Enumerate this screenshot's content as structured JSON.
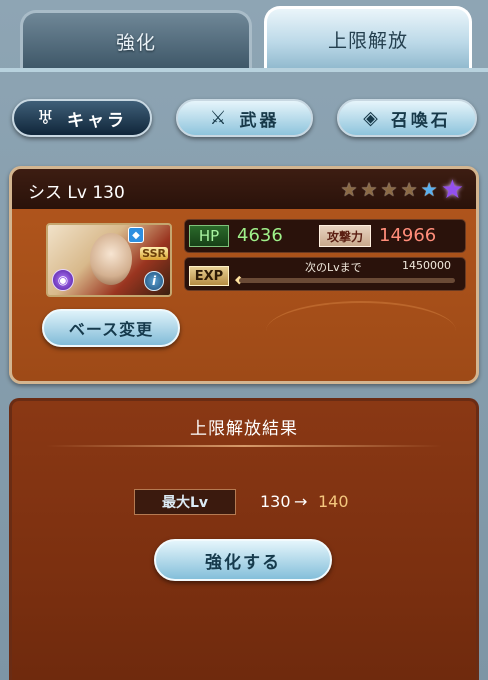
{
  "tabs": {
    "enhance": "強化",
    "limit_break": "上限解放"
  },
  "categories": {
    "chara": "キャラ",
    "weapon": "武器",
    "summon": "召喚石"
  },
  "icons": {
    "chara": "character-crest-icon",
    "weapon": "crossed-swords-icon",
    "summon": "crystal-icon",
    "stars": "star-icon",
    "water": "water-element-icon",
    "element": "element-orb-icon",
    "info": "info-icon"
  },
  "character": {
    "name": "シス",
    "lv_label": "Lv",
    "level": "130",
    "rarity": "SSR",
    "stars_filled": 4,
    "stars_total": 6,
    "hp_label": "HP",
    "hp": "4636",
    "atk_label": "攻撃力",
    "atk": "14966",
    "exp_label": "EXP",
    "next_lv_label": "次のLvまで",
    "next_lv_exp": "1450000",
    "exp_progress": 0
  },
  "base_change_button": "ベース変更",
  "result": {
    "title": "上限解放結果",
    "max_lv_label": "最大Lv",
    "from": "130",
    "arrow": "→",
    "to": "140"
  },
  "enhance_button": "強化する",
  "colors": {
    "card_bg": "#b3571d",
    "result_bg": "#7c3010",
    "hp_text": "#9ff08a",
    "atk_text": "#ff8d7a",
    "lv_to": "#f4c77e",
    "button_light": "#84bfda"
  }
}
